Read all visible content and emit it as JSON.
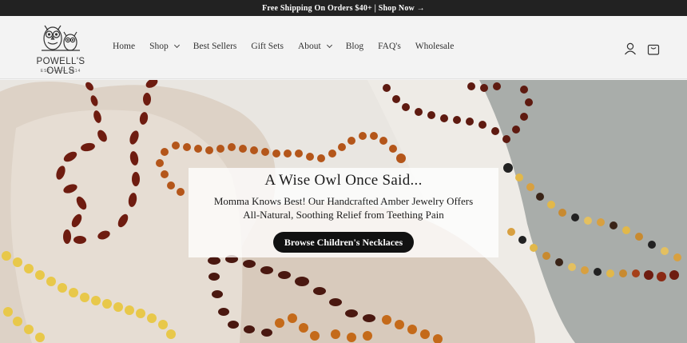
{
  "announcement": {
    "text": "Free Shipping On Orders $40+ | Shop Now →"
  },
  "brand": {
    "name": "POWELL'S OWLS",
    "established": "EST ——— 2014",
    "logo_icon": "owl-pair-icon"
  },
  "nav": {
    "home": "Home",
    "shop": "Shop",
    "best_sellers": "Best Sellers",
    "gift_sets": "Gift Sets",
    "about": "About",
    "blog": "Blog",
    "faqs": "FAQ's",
    "wholesale": "Wholesale"
  },
  "header_icons": {
    "account": "user-icon",
    "cart": "shopping-bag-icon"
  },
  "hero": {
    "title": "A Wise Owl Once Said...",
    "subtitle_line1": "Momma Knows Best! Our Handcrafted Amber Jewelry Offers",
    "subtitle_line2": "All-Natural, Soothing Relief from Teething Pain",
    "cta": "Browse Children's Necklaces"
  },
  "colors": {
    "announcement_bg": "#222222",
    "header_bg": "#f3f3f3",
    "cta_bg": "#111111",
    "amber_dark": "#6e1c10",
    "amber_honey": "#c46a1a",
    "amber_lemon": "#e8c84a"
  }
}
